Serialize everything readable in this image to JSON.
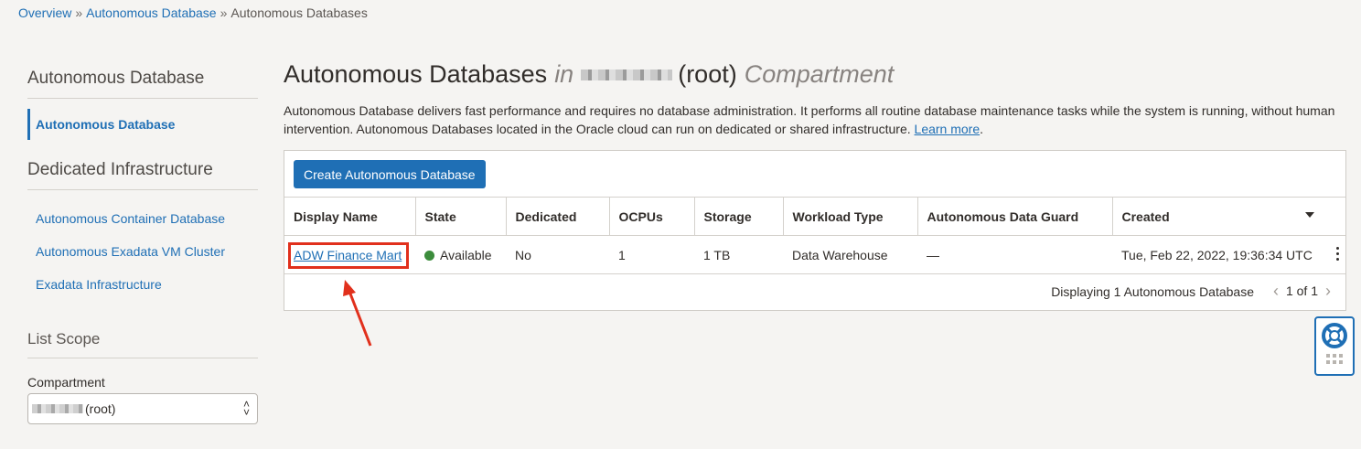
{
  "breadcrumb": {
    "items": [
      "Overview",
      "Autonomous Database",
      "Autonomous Databases"
    ],
    "separator": "»"
  },
  "sidebar": {
    "heading": "Autonomous Database",
    "active_item": "Autonomous Database",
    "section_heading": "Dedicated Infrastructure",
    "links": [
      "Autonomous Container Database",
      "Autonomous Exadata VM Cluster",
      "Exadata Infrastructure"
    ],
    "scope_heading": "List Scope",
    "compartment_label": "Compartment",
    "compartment_value": "(root)"
  },
  "main": {
    "title_prefix": "Autonomous Databases",
    "title_in": "in",
    "title_root": "(root)",
    "title_suffix": "Compartment",
    "description": "Autonomous Database delivers fast performance and requires no database administration. It performs all routine database maintenance tasks while the system is running, without human intervention. Autonomous Databases located in the Oracle cloud can run on dedicated or shared infrastructure.",
    "learn_more": "Learn more",
    "period": "."
  },
  "table": {
    "create_button": "Create Autonomous Database",
    "columns": [
      "Display Name",
      "State",
      "Dedicated",
      "OCPUs",
      "Storage",
      "Workload Type",
      "Autonomous Data Guard",
      "Created"
    ],
    "rows": [
      {
        "display_name": "ADW Finance Mart",
        "state": "Available",
        "dedicated": "No",
        "ocpus": "1",
        "storage": "1 TB",
        "workload_type": "Data Warehouse",
        "data_guard": "—",
        "created": "Tue, Feb 22, 2022, 19:36:34 UTC"
      }
    ],
    "footer_text": "Displaying 1 Autonomous Database",
    "page_info": "1 of 1"
  },
  "colors": {
    "accent": "#1f6fb5",
    "highlight": "#e1301c",
    "status_available": "#3c8c3c"
  }
}
